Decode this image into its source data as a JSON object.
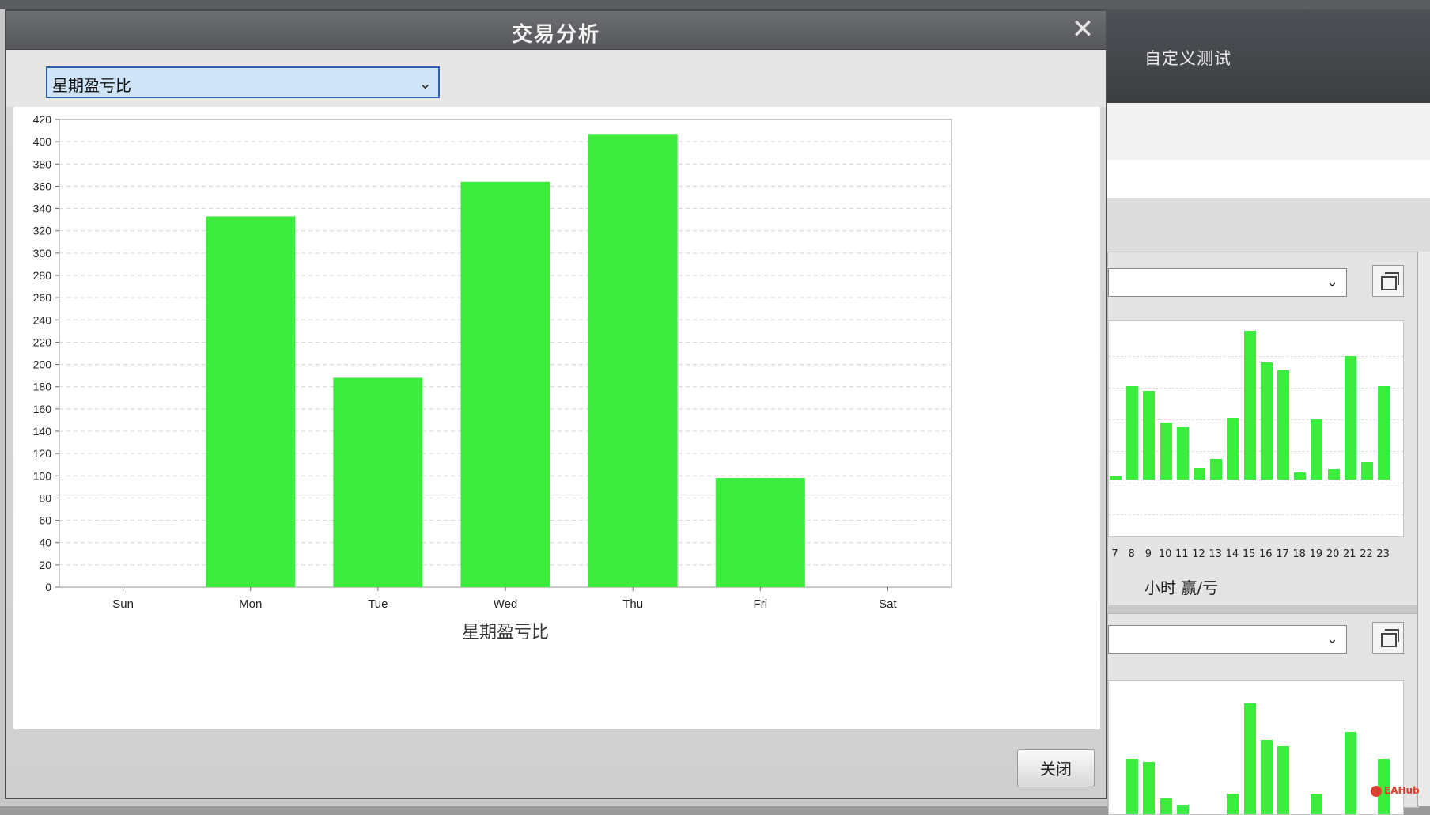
{
  "dialog": {
    "title": "交易分析",
    "close_icon": "close-icon",
    "metric_select": {
      "value": "星期盈亏比",
      "icon": "chevron-down-icon"
    },
    "close_button_label": "关闭"
  },
  "background_app": {
    "header_title": "自定义测试",
    "hourly_chart": {
      "hour_labels": [
        "7",
        "8",
        "9",
        "10",
        "11",
        "12",
        "13",
        "14",
        "15",
        "16",
        "17",
        "18",
        "19",
        "20",
        "21",
        "22",
        "23"
      ],
      "caption": "小时 赢/亏"
    },
    "watermark": "EAHub"
  },
  "colors": {
    "bar": "#3deb3d",
    "title_bar": "#5f6165",
    "select_bg": "#cfe5f7"
  },
  "chart_data": {
    "type": "bar",
    "categories": [
      "Sun",
      "Mon",
      "Tue",
      "Wed",
      "Thu",
      "Fri",
      "Sat"
    ],
    "values": [
      0,
      333,
      188,
      364,
      407,
      98,
      0
    ],
    "title": "",
    "xlabel": "星期盈亏比",
    "ylabel": "",
    "ylim": [
      0,
      420
    ],
    "yticks": [
      0,
      20,
      40,
      60,
      80,
      100,
      120,
      140,
      160,
      180,
      200,
      220,
      240,
      260,
      280,
      300,
      320,
      340,
      360,
      380,
      400,
      420
    ],
    "grid": true,
    "bar_color": "#3deb3d"
  }
}
